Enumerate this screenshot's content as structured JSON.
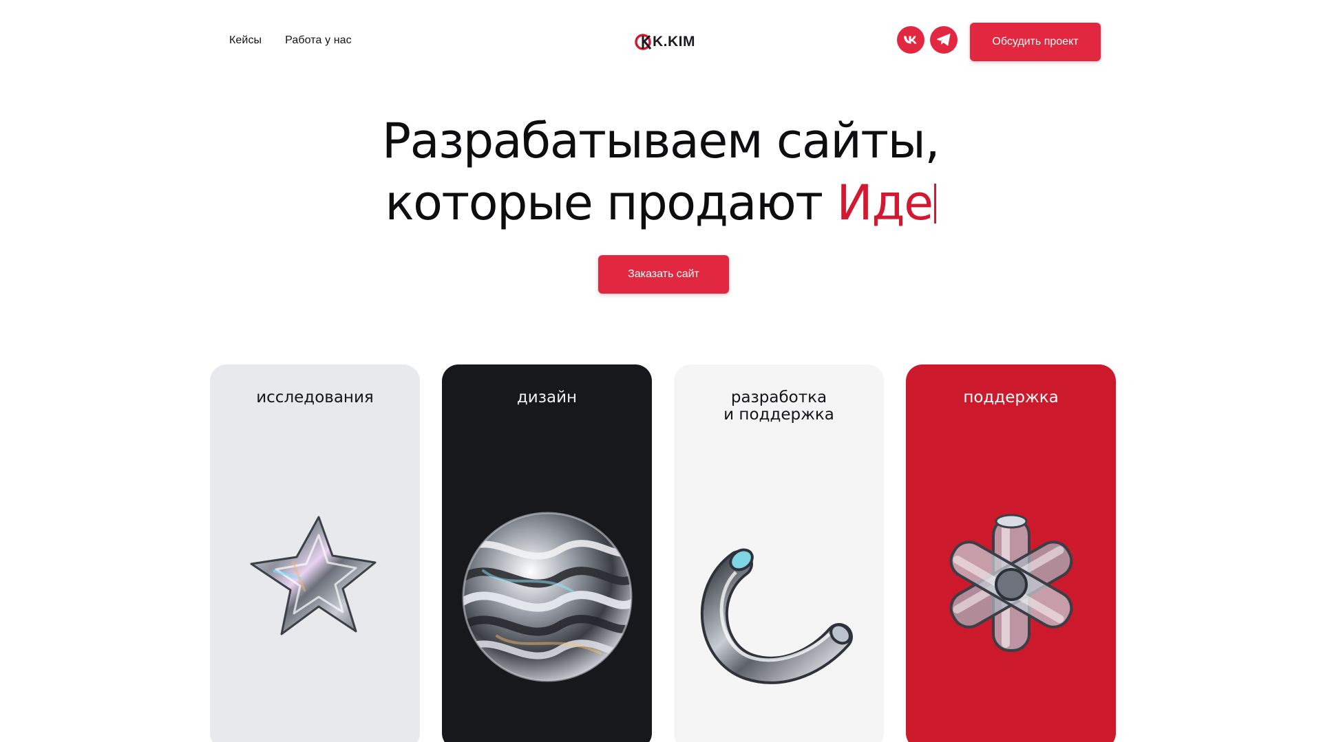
{
  "nav": {
    "items": [
      {
        "label": "Кейсы"
      },
      {
        "label": "Работа у нас"
      }
    ]
  },
  "logo": {
    "text": "K.KIM"
  },
  "social": {
    "vk_label": "vk",
    "telegram_label": "telegram"
  },
  "header": {
    "cta_label": "Обсудить проект"
  },
  "hero": {
    "line1": "Разрабатываем сайты,",
    "line2_prefix": "которые продают ",
    "line2_accent": "Иде",
    "cta_label": "Заказать сайт"
  },
  "cards": [
    {
      "title": "исследования",
      "shape": "glass-star-icon"
    },
    {
      "title": "дизайн",
      "shape": "glass-sphere-icon"
    },
    {
      "title": "разработка\nи поддержка",
      "title_line1": "разработка",
      "title_line2": "и поддержка",
      "shape": "glass-tube-icon"
    },
    {
      "title": "поддержка",
      "shape": "glass-asterisk-icon"
    }
  ],
  "colors": {
    "accent": "#e12840",
    "card_dark": "#17181c",
    "card_red": "#cc1a2c",
    "card_gray": "#e8e9ed",
    "card_light": "#f5f5f6"
  }
}
